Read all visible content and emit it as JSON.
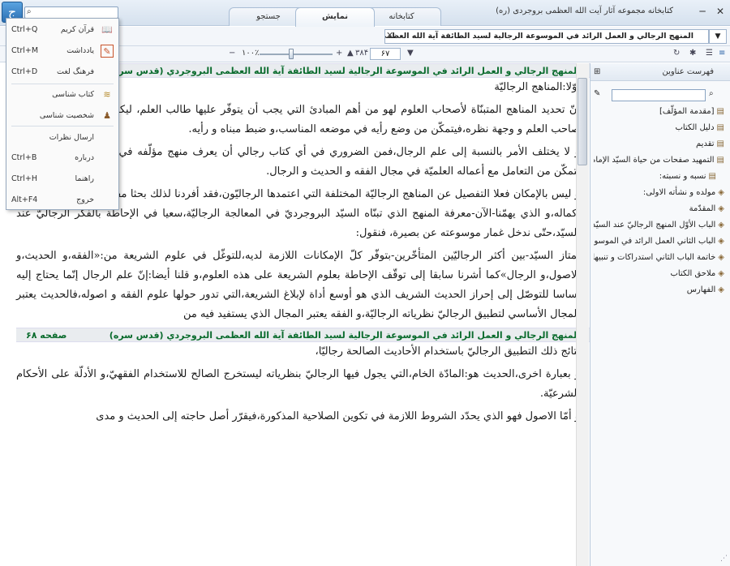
{
  "window": {
    "title": "کتابخانه مجموعه آثار آیت الله العظمی بروجردی (ره)",
    "minimize": "─",
    "close": "✕"
  },
  "app": {
    "logo": "ج"
  },
  "tabs": [
    {
      "label": "کتابخانه"
    },
    {
      "label": "نمایش"
    },
    {
      "label": "جستجو"
    }
  ],
  "toolbar": {
    "doc_title": "المنهج الرجالي و العمل الرائد في الموسوعة الرجالية لسيد الطائفة آية الله العظمى البروجردي (قدس سره)",
    "close_glyph": "✕",
    "zoom": "۱۰۰٪",
    "page_current": "۶۷",
    "page_total": "۳۸۴"
  },
  "menu": {
    "items": [
      {
        "label": "قرآن کریم",
        "shortcut": "Ctrl+Q",
        "icon": "book-open-icon"
      },
      {
        "label": "یادداشت",
        "shortcut": "Ctrl+M",
        "icon": "note-icon"
      },
      {
        "label": "فرهنگ لغت",
        "shortcut": "Ctrl+D",
        "icon": ""
      },
      {
        "label": "کتاب شناسی",
        "shortcut": "",
        "icon": "books-icon"
      },
      {
        "label": "شخصیت شناسی",
        "shortcut": "",
        "icon": "person-icon"
      },
      {
        "label": "ارسال نظرات",
        "shortcut": "",
        "icon": ""
      },
      {
        "label": "درباره",
        "shortcut": "Ctrl+B",
        "icon": ""
      },
      {
        "label": "راهنما",
        "shortcut": "Ctrl+H",
        "icon": ""
      },
      {
        "label": "خروج",
        "shortcut": "Alt+F4",
        "icon": ""
      }
    ]
  },
  "content": {
    "header1": "المنهج الرجالي و العمل الرائد في الموسوعة الرجالية لسيد الطائفة آية الله العظمى البروجردي (قدس سره)",
    "heading": "أوّلا:المناهج الرجاليّة",
    "para1": "إنّ تحديد المناهج المتبنّاة لأصحاب العلوم لهو من أهم المبادئ التي يجب أن يتوفّر عليها طالب العلم، ليكون على بصيرة من أمر صاحب العلم و وجهة نظره،فيتمكّن من وضع رأيه في موضعه المناسب،و ضبط مبناه و رأيه.",
    "para2": "و لا يختلف الأمر بالنسبة إلى علم الرجال،فمن الضروري في أي كتاب رجالي أن يعرف منهج مؤلّفه في المعالجة الرجاليّة حتّى يتمكّن من التعامل مع أعماله العلميّة في مجال الفقه و الحديث و الرجال.",
    "para3": "و ليس بالإمكان فعلا التفصيل عن المناهج الرجاليّة المختلفة التي اعتمدها الرجاليّون،فقد أفردنا لذلك بحثا مفصّلا نرجو أن نقدّمه بعد إكماله،و الذي يهمّنا-الآن-معرفة المنهج الذي تبنّاه السيّد البروجرديّ في المعالجة الرجاليّة،سعيا في الإحاطة بالفكر الرجاليّ عند السيّد،حتّى ندخل غمار موسوعته عن بصيرة، فنقول:",
    "para4": "يمتاز السيّد-بين أكثر الرجاليّين المتأخّرين-بتوفّر كلّ الإمكانات اللازمة لديه،للتوغّل في علوم الشريعة من:«الفقه،و الحديث،و الاصول،و الرجال»كما أشرنا سابقا إلى توقّف الإحاطة بعلوم الشريعة على هذه العلوم،و قلنا أيضا:إنّ علم الرجال إنّما يحتاج إليه أساسا للتوصّل إلى إحراز الحديث الشريف الذي هو أوسع أداة لإبلاغ الشريعة،التي تدور حولها علوم الفقه و اصوله،فالحديث يعتبر المجال الأساسي لتطبيق الرجاليّ نظرياته الرجاليّة،و الفقه يعتبر المجال الذي يستفيد فيه من",
    "header2": "المنهج الرجالي و العمل الرائد في الموسوعة الرجالية لسيد الطائفة آية الله العظمى البروجردي (قدس سره)",
    "page_label": "صفحه ۶۸",
    "para5": "نتائج ذلك التطبيق الرجاليّ باستخدام الأحاديث الصالحة رجاليّا،",
    "para6": "و بعبارة اخرى،الحديث هو:المادّة الخام،التي يجول فيها الرجاليّ بنظرياته ليستخرج الصالح للاستخدام الفقهيّ،و الأدلّة على الأحكام الشرعيّة.",
    "para7": "و أمّا الاصول فهو الذي يحدّد الشروط اللازمة في تكوين الصلاحية المذكورة،فيقرّر أصل حاجته إلى الحديث و مدى"
  },
  "sidebar": {
    "title": "فهرست عناوین",
    "items": [
      {
        "label": "[مقدمة المؤلّف]"
      },
      {
        "label": "دليل الكتاب"
      },
      {
        "label": "تقديم"
      },
      {
        "label": "التمهيد صفحات من حياة السيّد الإمام"
      },
      {
        "label": "نسبه و نسبته:"
      },
      {
        "label": "مولده و نشأته الاولى:"
      },
      {
        "label": "المقدّمة"
      },
      {
        "label": "الباب الأوّل المنهج الرجاليّ عند السيّد"
      },
      {
        "label": "الباب الثاني العمل الرائد في الموسوعة"
      },
      {
        "label": "خاتمة الباب الثاني استدراكات و تنبيهات"
      },
      {
        "label": "ملاحق الكتاب"
      },
      {
        "label": "الفهارس"
      }
    ]
  }
}
